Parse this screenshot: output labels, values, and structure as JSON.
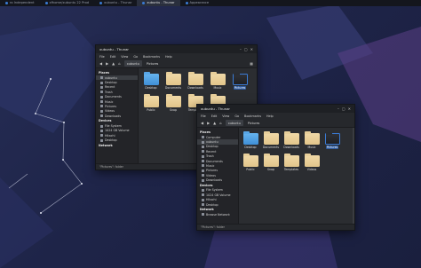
{
  "panel": {
    "tasks": [
      {
        "label": "ro Independent",
        "active": false
      },
      {
        "label": "xfhome/xubuntu 22 Prod",
        "active": false
      },
      {
        "label": "xubuntu - Thunar",
        "active": false
      },
      {
        "label": "xubuntu - Thunar",
        "active": true
      },
      {
        "label": "Appearance",
        "active": false
      }
    ]
  },
  "back_window": {
    "title": "xubuntu - Thunar",
    "menu": [
      "File",
      "Edit",
      "View",
      "Go",
      "Bookmarks",
      "Help"
    ],
    "crumbs": [
      "xubuntu",
      "Pictures"
    ],
    "sidebar": [
      {
        "type": "sec",
        "label": "Places"
      },
      {
        "type": "it",
        "label": "xubuntu",
        "sel": true
      },
      {
        "type": "it",
        "label": "Desktop"
      },
      {
        "type": "it",
        "label": "Recent"
      },
      {
        "type": "it",
        "label": "Trash"
      },
      {
        "type": "it",
        "label": "Documents"
      },
      {
        "type": "it",
        "label": "Music"
      },
      {
        "type": "it",
        "label": "Pictures"
      },
      {
        "type": "it",
        "label": "Videos"
      },
      {
        "type": "it",
        "label": "Downloads"
      },
      {
        "type": "sec",
        "label": "Devices"
      },
      {
        "type": "it",
        "label": "File System"
      },
      {
        "type": "it",
        "label": "1024 GB Volume"
      },
      {
        "type": "it",
        "label": "Hitachi"
      },
      {
        "type": "it",
        "label": "Desktop"
      },
      {
        "type": "sec",
        "label": "Network"
      }
    ],
    "files": [
      {
        "label": "Desktop",
        "kind": "blue"
      },
      {
        "label": "Documents",
        "kind": "plain"
      },
      {
        "label": "Downloads",
        "kind": "plain"
      },
      {
        "label": "Music",
        "kind": "plain"
      },
      {
        "label": "Pictures",
        "kind": "dark",
        "sel": true
      },
      {
        "label": "Public",
        "kind": "plain"
      },
      {
        "label": "Snap",
        "kind": "plain"
      },
      {
        "label": "Templates",
        "kind": "plain"
      },
      {
        "label": "Videos",
        "kind": "plain"
      }
    ],
    "status": "\"Pictures\": folder"
  },
  "front_window": {
    "title": "xubuntu - Thunar",
    "menu": [
      "File",
      "Edit",
      "View",
      "Go",
      "Bookmarks",
      "Help"
    ],
    "crumbs": [
      "xubuntu",
      "Pictures"
    ],
    "sidebar": [
      {
        "type": "sec",
        "label": "Places"
      },
      {
        "type": "it",
        "label": "Computer"
      },
      {
        "type": "it",
        "label": "xubuntu",
        "sel": true
      },
      {
        "type": "it",
        "label": "Desktop"
      },
      {
        "type": "it",
        "label": "Recent"
      },
      {
        "type": "it",
        "label": "Trash"
      },
      {
        "type": "it",
        "label": "Documents"
      },
      {
        "type": "it",
        "label": "Music"
      },
      {
        "type": "it",
        "label": "Pictures"
      },
      {
        "type": "it",
        "label": "Videos"
      },
      {
        "type": "it",
        "label": "Downloads"
      },
      {
        "type": "sec",
        "label": "Devices"
      },
      {
        "type": "it",
        "label": "File System"
      },
      {
        "type": "it",
        "label": "1024 GB Volume"
      },
      {
        "type": "it",
        "label": "Hitachi"
      },
      {
        "type": "it",
        "label": "Desktop"
      },
      {
        "type": "sec",
        "label": "Network"
      },
      {
        "type": "it",
        "label": "Browse Network"
      }
    ],
    "files": [
      {
        "label": "Desktop",
        "kind": "blue"
      },
      {
        "label": "Documents",
        "kind": "plain"
      },
      {
        "label": "Downloads",
        "kind": "plain"
      },
      {
        "label": "Music",
        "kind": "plain"
      },
      {
        "label": "Pictures",
        "kind": "dark",
        "sel": true
      },
      {
        "label": "Public",
        "kind": "plain"
      },
      {
        "label": "Snap",
        "kind": "plain"
      },
      {
        "label": "Templates",
        "kind": "plain"
      },
      {
        "label": "Videos",
        "kind": "plain"
      }
    ],
    "status": "\"Pictures\": folder"
  },
  "colors": {
    "accent": "#3a7bd5",
    "folder": "#e2c58a",
    "window_bg": "#2b2d31",
    "desktop_bg": "#1e2448"
  }
}
